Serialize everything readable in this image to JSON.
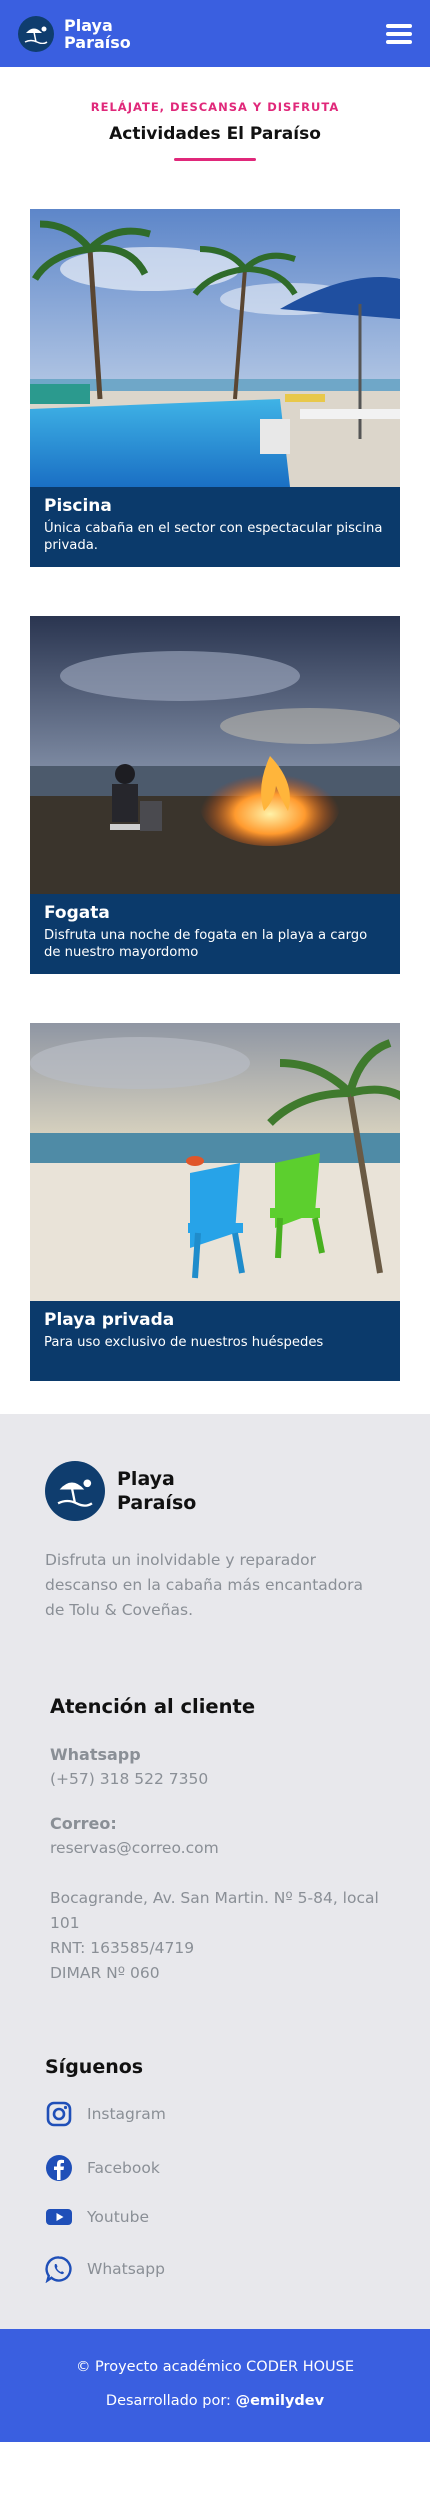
{
  "header": {
    "brand_line1": "Playa",
    "brand_line2": "Paraíso",
    "logo_icon": "beach-umbrella-icon",
    "menu_icon": "hamburger-menu-icon"
  },
  "intro": {
    "eyebrow": "RELÁJATE, DESCANSA Y DISFRUTA",
    "title": "Actividades El Paraíso"
  },
  "cards": [
    {
      "title": "Piscina",
      "text": "Única cabaña en el sector con espectacular piscina privada."
    },
    {
      "title": "Fogata",
      "text": "Disfruta una noche de fogata en la playa a cargo de nuestro mayordomo"
    },
    {
      "title": "Playa privada",
      "text": "Para uso exclusivo de nuestros huéspedes"
    }
  ],
  "footer": {
    "brand_line1": "Playa",
    "brand_line2": "Paraíso",
    "description": "Disfruta un inolvidable y reparador descanso en la cabaña más encantadora de Tolu & Coveñas.",
    "support_title": "Atención al cliente",
    "whatsapp_label": "Whatsapp",
    "whatsapp_value": "(+57) 318 522 7350",
    "email_label": "Correo:",
    "email_value": "reservas@correo.com",
    "address": "Bocagrande, Av. San Martin. Nº 5-84, local 101",
    "rnt": "RNT: 163585/4719",
    "dimar": "DIMAR Nº 060",
    "follow_title": "Síguenos",
    "social": [
      {
        "label": "Instagram",
        "icon": "instagram-icon"
      },
      {
        "label": "Facebook",
        "icon": "facebook-icon"
      },
      {
        "label": "Youtube",
        "icon": "youtube-icon"
      },
      {
        "label": "Whatsapp",
        "icon": "whatsapp-icon"
      }
    ]
  },
  "bottom": {
    "line1": "© Proyecto académico CODER HOUSE",
    "line2_prefix": "Desarrollado por: ",
    "handle": "@emilydev"
  },
  "colors": {
    "primary_blue": "#3a5fe0",
    "navy": "#0b3a6b",
    "accent_pink": "#e0287a",
    "footer_bg": "#e8e8ec"
  }
}
